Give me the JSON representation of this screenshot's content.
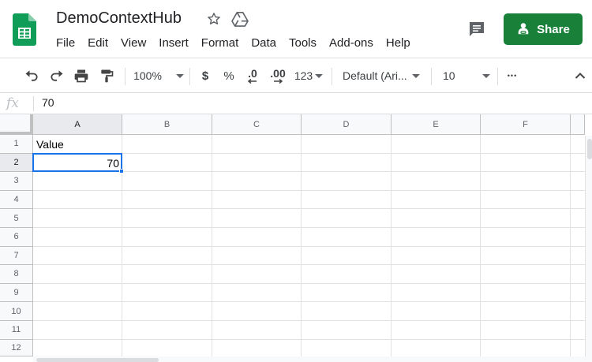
{
  "document": {
    "title": "DemoContextHub"
  },
  "menu": [
    "File",
    "Edit",
    "View",
    "Insert",
    "Format",
    "Data",
    "Tools",
    "Add-ons",
    "Help"
  ],
  "share": {
    "label": "Share"
  },
  "toolbar": {
    "zoom": "100%",
    "currency": "$",
    "percent": "%",
    "decrease_decimals": ".0",
    "increase_decimals": ".00",
    "more_formats": "123",
    "font": "Default (Ari...",
    "font_size": "10",
    "more": "•••"
  },
  "formula_bar": {
    "fx": "fx",
    "value": "70"
  },
  "grid": {
    "columns": [
      "A",
      "B",
      "C",
      "D",
      "E",
      "F"
    ],
    "rows": [
      "1",
      "2",
      "3",
      "4",
      "5",
      "6",
      "7",
      "8",
      "9",
      "10",
      "11",
      "12"
    ],
    "cells": {
      "A1": "Value",
      "A2": "70"
    },
    "selected": "A2"
  },
  "colors": {
    "accent": "#1a73e8",
    "share_green": "#188038",
    "sheets_green": "#0f9d58"
  },
  "icons": [
    "sheets-logo-icon",
    "star-icon",
    "drive-icon",
    "comment-icon",
    "share-person-icon",
    "undo-icon",
    "redo-icon",
    "print-icon",
    "paint-format-icon",
    "chevron-up-icon"
  ]
}
